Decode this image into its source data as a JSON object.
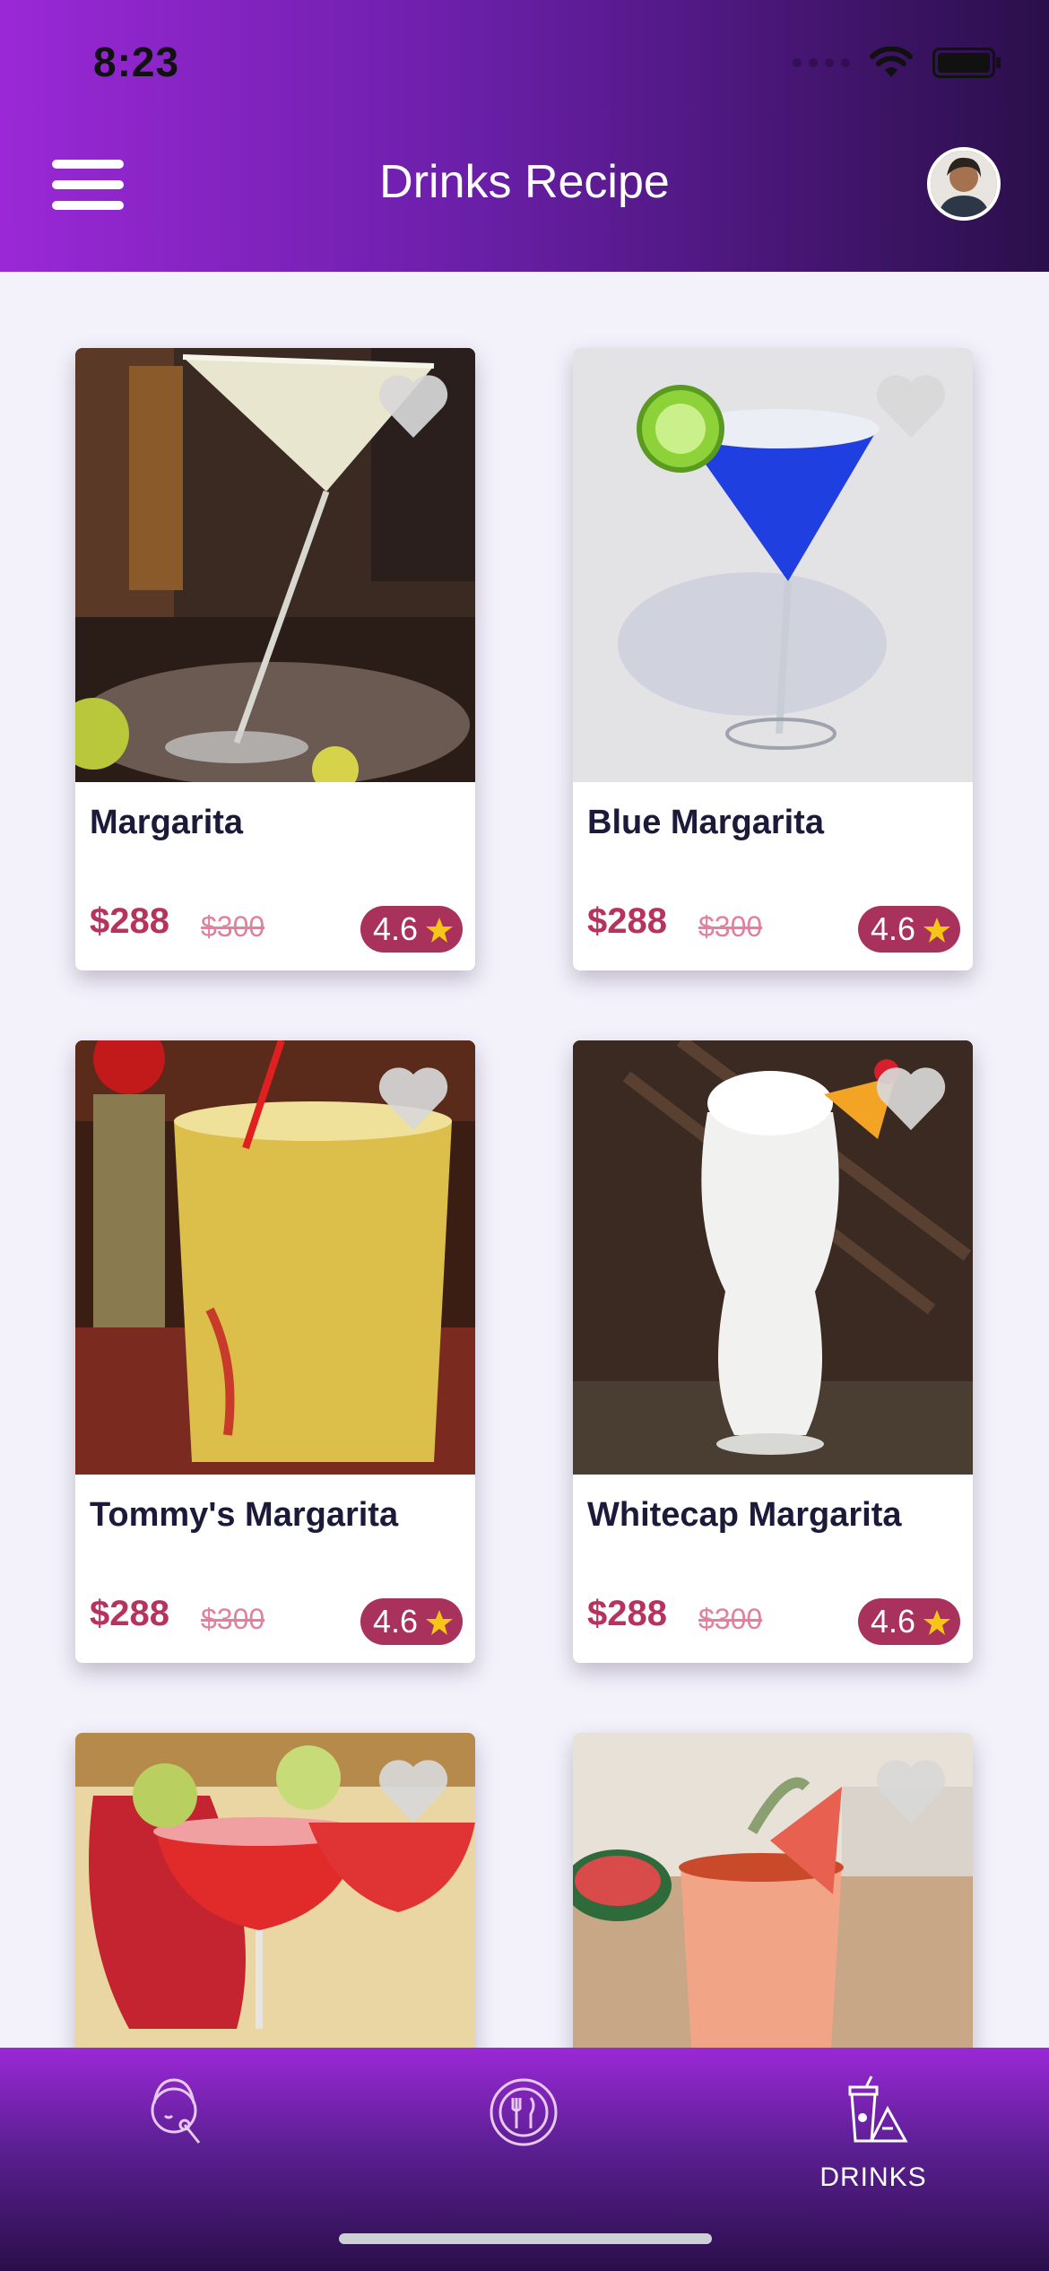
{
  "status_bar": {
    "time": "8:23"
  },
  "header": {
    "title": "Drinks Recipe"
  },
  "cards": [
    {
      "title": "Margarita",
      "price": "$288",
      "old_price": "$300",
      "rating": "4.6"
    },
    {
      "title": "Blue Margarita",
      "price": "$288",
      "old_price": "$300",
      "rating": "4.6"
    },
    {
      "title": "Tommy's Margarita",
      "price": "$288",
      "old_price": "$300",
      "rating": "4.6"
    },
    {
      "title": "Whitecap Margarita",
      "price": "$288",
      "old_price": "$300",
      "rating": "4.6"
    },
    {
      "title": "",
      "price": "",
      "old_price": "",
      "rating": ""
    },
    {
      "title": "",
      "price": "",
      "old_price": "",
      "rating": ""
    }
  ],
  "bottom_nav": {
    "items": [
      {
        "icon": "face-icon",
        "label": ""
      },
      {
        "icon": "plate-utensils-icon",
        "label": ""
      },
      {
        "icon": "drinks-icon",
        "label": "DRINKS"
      }
    ]
  },
  "colors": {
    "accent": "#9a28d6",
    "price": "#b5335d",
    "badge": "#a8325b",
    "star": "#f5c518"
  }
}
